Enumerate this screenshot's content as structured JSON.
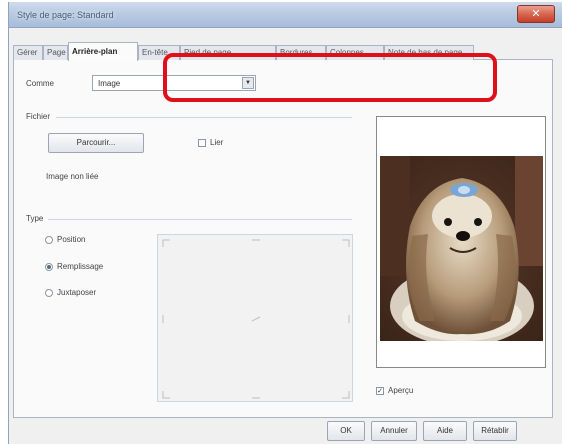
{
  "window": {
    "title": "Style de page: Standard",
    "close_glyph": "✕"
  },
  "tabs": [
    {
      "label": "Gérer"
    },
    {
      "label": "Page"
    },
    {
      "label": "Arrière-plan"
    },
    {
      "label": "En-tête"
    },
    {
      "label": "Pied de page"
    },
    {
      "label": "Bordures"
    },
    {
      "label": "Colonnes"
    },
    {
      "label": "Note de bas de page"
    }
  ],
  "as_row": {
    "label": "Comme",
    "value": "Image",
    "arrow": "▼"
  },
  "file_section": {
    "title": "Fichier",
    "browse_label": "Parcourir...",
    "link_label": "Lier",
    "status": "Image non liée"
  },
  "type_section": {
    "title": "Type",
    "options": [
      {
        "label": "Position",
        "checked": false
      },
      {
        "label": "Remplissage",
        "checked": true
      },
      {
        "label": "Juxtaposer",
        "checked": false
      }
    ]
  },
  "preview": {
    "label": "Aperçu",
    "checked": true,
    "check_glyph": "✓"
  },
  "buttons": {
    "ok": "OK",
    "cancel": "Annuler",
    "help": "Aide",
    "reset": "Rétablir"
  },
  "colors": {
    "accent_highlight": "#e0101a",
    "titlebar": "#b9cbe2"
  },
  "icons": {
    "close": "close-icon",
    "dropdown": "chevron-down-icon"
  }
}
